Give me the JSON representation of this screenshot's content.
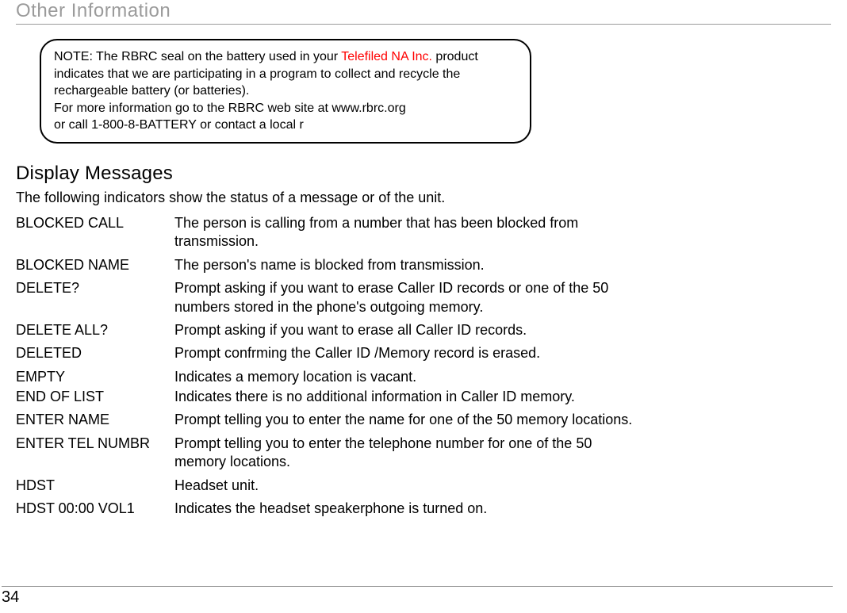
{
  "section_header": "Other Information",
  "note": {
    "line1a": "NOTE: The RBRC seal on the battery used in your ",
    "line1b": "Telefiled NA Inc.",
    "line1c": " product",
    "line2": "indicates that we are participating in a program to collect and recycle the",
    "line3": "rechargeable battery (or batteries).",
    "line4": "For more information go to the RBRC web site at www.rbrc.org",
    "line5": "or call 1-800-8-BATTERY or contact a local r"
  },
  "subheading": "Display Messages",
  "intro": "The following indicators show the status of a message or of the unit.",
  "messages": [
    {
      "term": "BLOCKED CALL",
      "desc": "The person is calling from a number that has been blocked from transmission."
    },
    {
      "term": "BLOCKED NAME",
      "desc": "The person's name is blocked from transmission."
    },
    {
      "term": "DELETE?",
      "desc": "Prompt asking if you want to erase Caller ID records or one of the 50 numbers stored in the phone's outgoing memory."
    },
    {
      "term": "DELETE ALL?",
      "desc": "Prompt asking if you want to erase all Caller ID records."
    },
    {
      "term": "DELETED",
      "desc": "Prompt confrming the Caller ID /Memory record is erased."
    },
    {
      "term": "EMPTY",
      "desc": "Indicates a memory location is vacant."
    },
    {
      "term": "END OF LIST",
      "desc": "Indicates there is no additional information in Caller ID memory."
    },
    {
      "term": "ENTER NAME",
      "desc": "Prompt telling you to enter the name for one of the 50 memory locations."
    },
    {
      "term": "ENTER TEL NUMBR",
      "desc": "Prompt telling you to enter the telephone number for one of the 50 memory locations."
    },
    {
      "term": "HDST",
      "desc": "Headset unit."
    },
    {
      "term": "HDST 00:00 VOL1",
      "desc": "Indicates the headset speakerphone is turned on."
    }
  ],
  "page_number": "34"
}
